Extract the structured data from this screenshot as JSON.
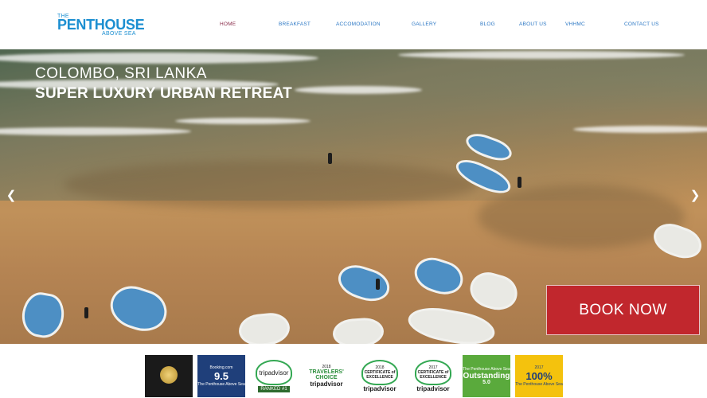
{
  "logo": {
    "line1": "THE",
    "line2": "PENTHOUSE",
    "line3": "ABOVE SEA"
  },
  "nav": {
    "items": [
      {
        "label": "HOME",
        "active": true
      },
      {
        "label": "BREAKFAST",
        "active": false
      },
      {
        "label": "ACCOMODATION",
        "active": false
      },
      {
        "label": "GALLERY",
        "active": false
      },
      {
        "label": "BLOG",
        "active": false
      },
      {
        "label": "ABOUT US",
        "active": false
      },
      {
        "label": "VHHMC",
        "active": false
      },
      {
        "label": "CONTACT US",
        "active": false
      }
    ]
  },
  "hero": {
    "subtitle": "COLOMBO, SRI LANKA",
    "title": "SUPER LUXURY URBAN RETREAT",
    "prev_icon": "chevron-left-icon",
    "next_icon": "chevron-right-icon",
    "book_label": "BOOK NOW"
  },
  "awards": [
    {
      "kind": "dark",
      "big": "",
      "small": ""
    },
    {
      "kind": "navy",
      "small_top": "Booking.com",
      "big": "9.5",
      "small": "The Penthouse Above Sea"
    },
    {
      "kind": "ta",
      "word": "tripadvisor",
      "badge": "RANKED #1"
    },
    {
      "kind": "ta",
      "year": "2018",
      "word": "TRAVELERS' CHOICE",
      "badge": "tripadvisor"
    },
    {
      "kind": "ta",
      "year": "2018",
      "word": "CERTIFICATE of EXCELLENCE",
      "badge": "tripadvisor"
    },
    {
      "kind": "ta",
      "year": "2017",
      "word": "CERTIFICATE of EXCELLENCE",
      "badge": "tripadvisor"
    },
    {
      "kind": "green",
      "small_top": "The Penthouse Above Sea",
      "big": "Outstanding",
      "small": "5.0"
    },
    {
      "kind": "yellow",
      "small_top": "2017",
      "big": "100%",
      "small": "The Penthouse Above Sea"
    }
  ],
  "colors": {
    "brand_blue": "#1c8fd1",
    "nav_blue": "#2b77c4",
    "nav_active": "#8a2c4a",
    "book_red": "#c1272d"
  }
}
